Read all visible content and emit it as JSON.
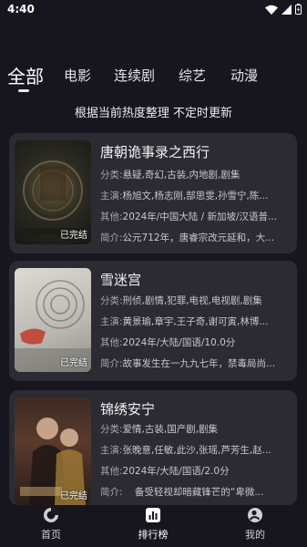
{
  "status": {
    "time": "4:40"
  },
  "tabs": [
    {
      "label": "全部"
    },
    {
      "label": "电影"
    },
    {
      "label": "连续剧"
    },
    {
      "label": "综艺"
    },
    {
      "label": "动漫"
    }
  ],
  "subtitle": "根据当前热度整理 不定时更新",
  "cards": [
    {
      "title": "唐朝诡事录之西行",
      "badge": "已完结",
      "genre_label": "分类:",
      "genre": "悬疑,奇幻,古装,内地剧,剧集",
      "cast_label": "主演:",
      "cast": "杨旭文,杨志刚,郜思雯,孙雪宁,陈...",
      "other_label": "其他:",
      "other": "2024年/中国大陆 / 新加坡/汉语普...",
      "intro_label": "简介:",
      "intro": "公元712年，唐睿宗改元延和，大..."
    },
    {
      "title": "雪迷宫",
      "badge": "已完结",
      "genre_label": "分类:",
      "genre": "刑侦,剧情,犯罪,电视,电视剧,剧集",
      "cast_label": "主演:",
      "cast": "黄景瑜,章宇,王子奇,谢可寅,林博...",
      "other_label": "其他:",
      "other": "2024年/大陆/国语/10.0分",
      "intro_label": "简介:",
      "intro": "故事发生在一九九七年，禁毒局尚..."
    },
    {
      "title": "锦绣安宁",
      "badge": "已完结",
      "genre_label": "分类:",
      "genre": "爱情,古装,国产剧,剧集",
      "cast_label": "主演:",
      "cast": "张晚意,任敏,此沙,张瑶,芦芳生,赵...",
      "other_label": "其他:",
      "other": "2024年/大陆/国语/2.0分",
      "intro_label": "简介:",
      "intro": "    备受轻视却暗藏锋芒的“卑微..."
    }
  ],
  "nav": [
    {
      "label": "首页"
    },
    {
      "label": "排行榜"
    },
    {
      "label": "我的"
    }
  ]
}
